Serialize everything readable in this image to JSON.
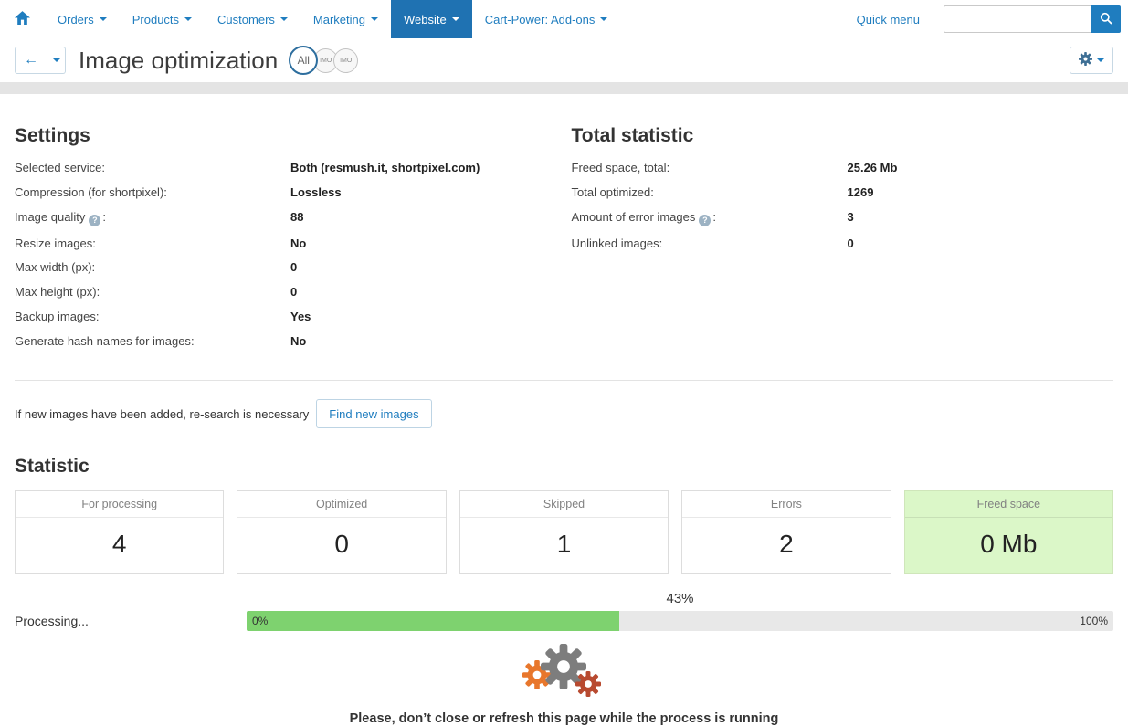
{
  "colors": {
    "accent": "#1f7dbf",
    "active_nav_bg": "#1f72b2",
    "progress_green": "#7ed26f",
    "highlight_green": "#dbf7c8",
    "gear_orange": "#e8772c",
    "gear_gray": "#7d7d7d",
    "gear_red": "#b84a30",
    "toolbar_icon": "#3e6f95"
  },
  "topnav": {
    "items": [
      {
        "label": "Orders",
        "active": false
      },
      {
        "label": "Products",
        "active": false
      },
      {
        "label": "Customers",
        "active": false
      },
      {
        "label": "Marketing",
        "active": false
      },
      {
        "label": "Website",
        "active": true
      },
      {
        "label": "Cart-Power: Add-ons",
        "active": false
      }
    ],
    "quick_menu_label": "Quick menu"
  },
  "search": {
    "value": ""
  },
  "toolbar": {
    "title": "Image optimization",
    "store_selector": {
      "all_label": "All",
      "badges": [
        "IMO",
        "IMO"
      ]
    }
  },
  "settings": {
    "heading": "Settings",
    "rows": [
      {
        "label": "Selected service",
        "value": "Both (resmush.it, shortpixel.com)"
      },
      {
        "label": "Compression (for shortpixel)",
        "value": "Lossless"
      },
      {
        "label": "Image quality",
        "help": true,
        "value": "88"
      },
      {
        "label": "Resize images",
        "value": "No"
      },
      {
        "label": "Max width (px)",
        "value": "0"
      },
      {
        "label": "Max height (px)",
        "value": "0"
      },
      {
        "label": "Backup images",
        "value": "Yes"
      },
      {
        "label": "Generate hash names for images",
        "value": "No"
      }
    ]
  },
  "total_statistic": {
    "heading": "Total statistic",
    "rows": [
      {
        "label": "Freed space, total",
        "value": "25.26 Mb"
      },
      {
        "label": "Total optimized",
        "value": "1269"
      },
      {
        "label": "Amount of error images",
        "help": true,
        "value": "3"
      },
      {
        "label": "Unlinked images",
        "value": "0"
      }
    ]
  },
  "research": {
    "text": "If new images have been added, re-search is necessary",
    "button_label": "Find new images"
  },
  "statistic": {
    "heading": "Statistic",
    "cards": [
      {
        "label": "For processing",
        "value": "4",
        "highlight": false
      },
      {
        "label": "Optimized",
        "value": "0",
        "highlight": false
      },
      {
        "label": "Skipped",
        "value": "1",
        "highlight": false
      },
      {
        "label": "Errors",
        "value": "2",
        "highlight": false
      },
      {
        "label": "Freed space",
        "value": "0 Mb",
        "highlight": true
      }
    ]
  },
  "progress": {
    "label": "Processing...",
    "percent": 43,
    "percent_label": "43%",
    "min_label": "0%",
    "max_label": "100%"
  },
  "footer_note": "Please, don’t close or refresh this page while the process is running"
}
